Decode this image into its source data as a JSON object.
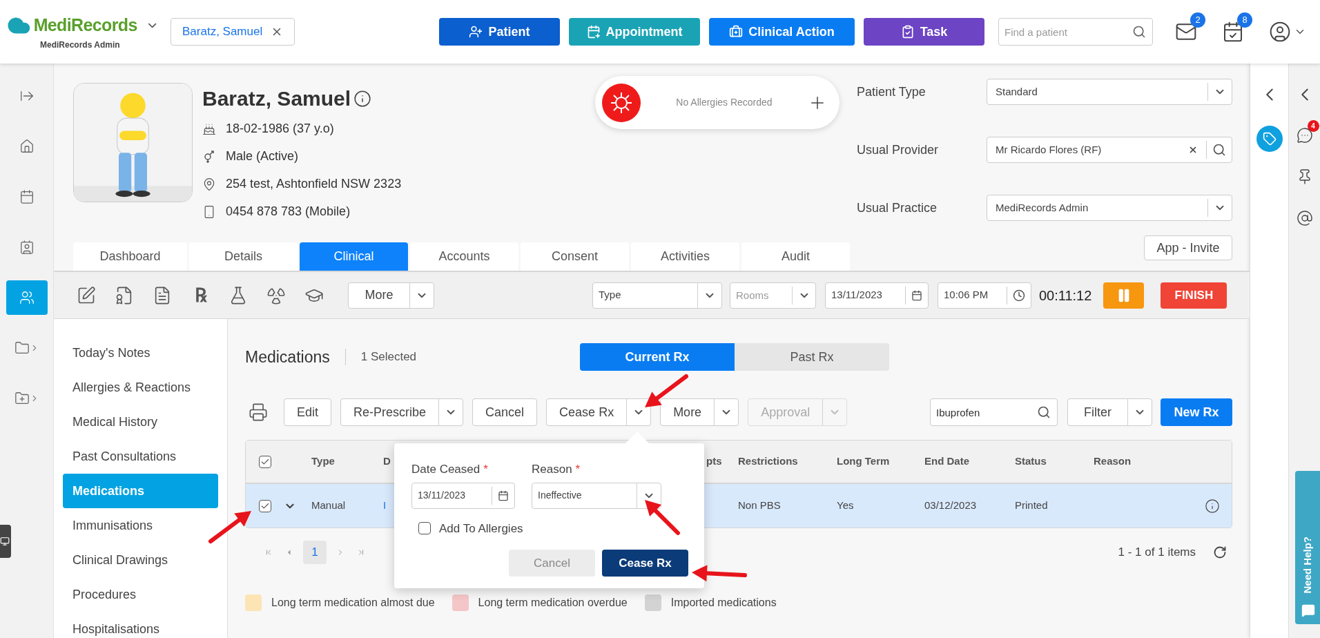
{
  "header": {
    "brand": "MediRecords",
    "practice": "MediRecords Admin",
    "open_patient": "Baratz, Samuel",
    "actions": [
      {
        "label": "Patient",
        "kind": "patient",
        "color": "#0b5fce"
      },
      {
        "label": "Appointment",
        "kind": "appointment",
        "color": "#1aa3b5"
      },
      {
        "label": "Clinical Action",
        "kind": "clinical",
        "color": "#0a7cf2"
      },
      {
        "label": "Task",
        "kind": "task",
        "color": "#6d44c4"
      }
    ],
    "search": {
      "placeholder": "Find a patient"
    },
    "notifications": [
      {
        "kind": "mail",
        "count": "2"
      },
      {
        "kind": "calendar",
        "count": "8"
      }
    ]
  },
  "rail": [
    {
      "kind": "collapse",
      "selected": false
    },
    {
      "kind": "home",
      "selected": false
    },
    {
      "kind": "calendar",
      "selected": false
    },
    {
      "kind": "contacts",
      "selected": false
    },
    {
      "kind": "patients",
      "selected": true
    },
    {
      "kind": "folder",
      "selected": false
    },
    {
      "kind": "folder-add",
      "selected": false
    }
  ],
  "patient": {
    "name": "Baratz, Samuel",
    "details": [
      {
        "kind": "dob",
        "text": "18-02-1986 (37 y.o)"
      },
      {
        "kind": "gender",
        "text": "Male (Active)"
      },
      {
        "kind": "address",
        "text": "254 test, Ashtonfield NSW 2323"
      },
      {
        "kind": "phone",
        "text": "0454 878 783 (Mobile)"
      }
    ]
  },
  "allergies": {
    "text": "No Allergies Recorded"
  },
  "fields": [
    {
      "label": "Patient Type",
      "value": "Standard",
      "kind": "select"
    },
    {
      "label": "Usual Provider",
      "value": "Mr Ricardo Flores (RF)",
      "kind": "search"
    },
    {
      "label": "Usual Practice",
      "value": "MediRecords Admin",
      "kind": "select"
    }
  ],
  "app_invite": "App - Invite",
  "tabs": [
    {
      "label": "Dashboard",
      "selected": false
    },
    {
      "label": "Details",
      "selected": false
    },
    {
      "label": "Clinical",
      "selected": true
    },
    {
      "label": "Accounts",
      "selected": false
    },
    {
      "label": "Consent",
      "selected": false
    },
    {
      "label": "Activities",
      "selected": false
    },
    {
      "label": "Audit",
      "selected": false
    }
  ],
  "toolbar": {
    "tools": [
      {
        "kind": "note"
      },
      {
        "kind": "certificate"
      },
      {
        "kind": "chart"
      },
      {
        "kind": "rx",
        "symbol": "℞"
      },
      {
        "kind": "lab"
      },
      {
        "kind": "radiology"
      },
      {
        "kind": "education"
      }
    ],
    "more": "More",
    "type": "Type",
    "rooms_placeholder": "Rooms",
    "date": "13/11/2023",
    "time": "10:06 PM",
    "timer": "00:11:12",
    "finish": "FINISH"
  },
  "nav": [
    {
      "label": "Today's Notes",
      "selected": false
    },
    {
      "label": "Allergies & Reactions",
      "selected": false
    },
    {
      "label": "Medical History",
      "selected": false
    },
    {
      "label": "Past Consultations",
      "selected": false
    },
    {
      "label": "Medications",
      "selected": true
    },
    {
      "label": "Immunisations",
      "selected": false
    },
    {
      "label": "Clinical Drawings",
      "selected": false
    },
    {
      "label": "Procedures",
      "selected": false
    },
    {
      "label": "Hospitalisations",
      "selected": false
    }
  ],
  "medications": {
    "title": "Medications",
    "selected_count": "1 Selected",
    "views": [
      {
        "label": "Current Rx",
        "selected": true
      },
      {
        "label": "Past Rx",
        "selected": false
      }
    ],
    "actions": [
      {
        "label": "Edit",
        "split": false,
        "disabled": false
      },
      {
        "label": "Re-Prescribe",
        "split": true,
        "disabled": false
      },
      {
        "label": "Cancel",
        "split": false,
        "disabled": false
      },
      {
        "label": "Cease Rx",
        "split": true,
        "disabled": false
      },
      {
        "label": "More",
        "split": true,
        "disabled": false
      },
      {
        "label": "Approval",
        "split": true,
        "disabled": true
      }
    ],
    "search": {
      "value": "Ibuprofen"
    },
    "filter": "Filter",
    "new_rx": "New Rx",
    "table": {
      "all_checked": true,
      "columns": [
        "Type",
        "D",
        "pts",
        "Restrictions",
        "Long Term",
        "End Date",
        "Status",
        "Reason"
      ],
      "rows": [
        {
          "checked": true,
          "selected": true,
          "cells": [
            "Manual",
            "I",
            "",
            "Non PBS",
            "Yes",
            "03/12/2023",
            "Printed",
            ""
          ]
        }
      ]
    },
    "pagination": {
      "page": "1",
      "summary": "1 - 1 of 1 items"
    },
    "legend": [
      {
        "label": "Long term medication almost due",
        "color": "#fde4b4"
      },
      {
        "label": "Long term medication overdue",
        "color": "#f5c6c8"
      },
      {
        "label": "Imported medications",
        "color": "#d3d3d3"
      }
    ]
  },
  "cease_popup": {
    "date_required": "*",
    "reason_required": "*",
    "date_label": "Date Ceased",
    "date": "13/11/2023",
    "reason_label": "Reason",
    "reason": "Ineffective",
    "add_to_allergies": {
      "label": "Add To Allergies",
      "checked": false
    },
    "cancel": "Cancel",
    "confirm": "Cease Rx"
  },
  "side": {
    "chat_count": "4",
    "help": "Need Help?"
  }
}
